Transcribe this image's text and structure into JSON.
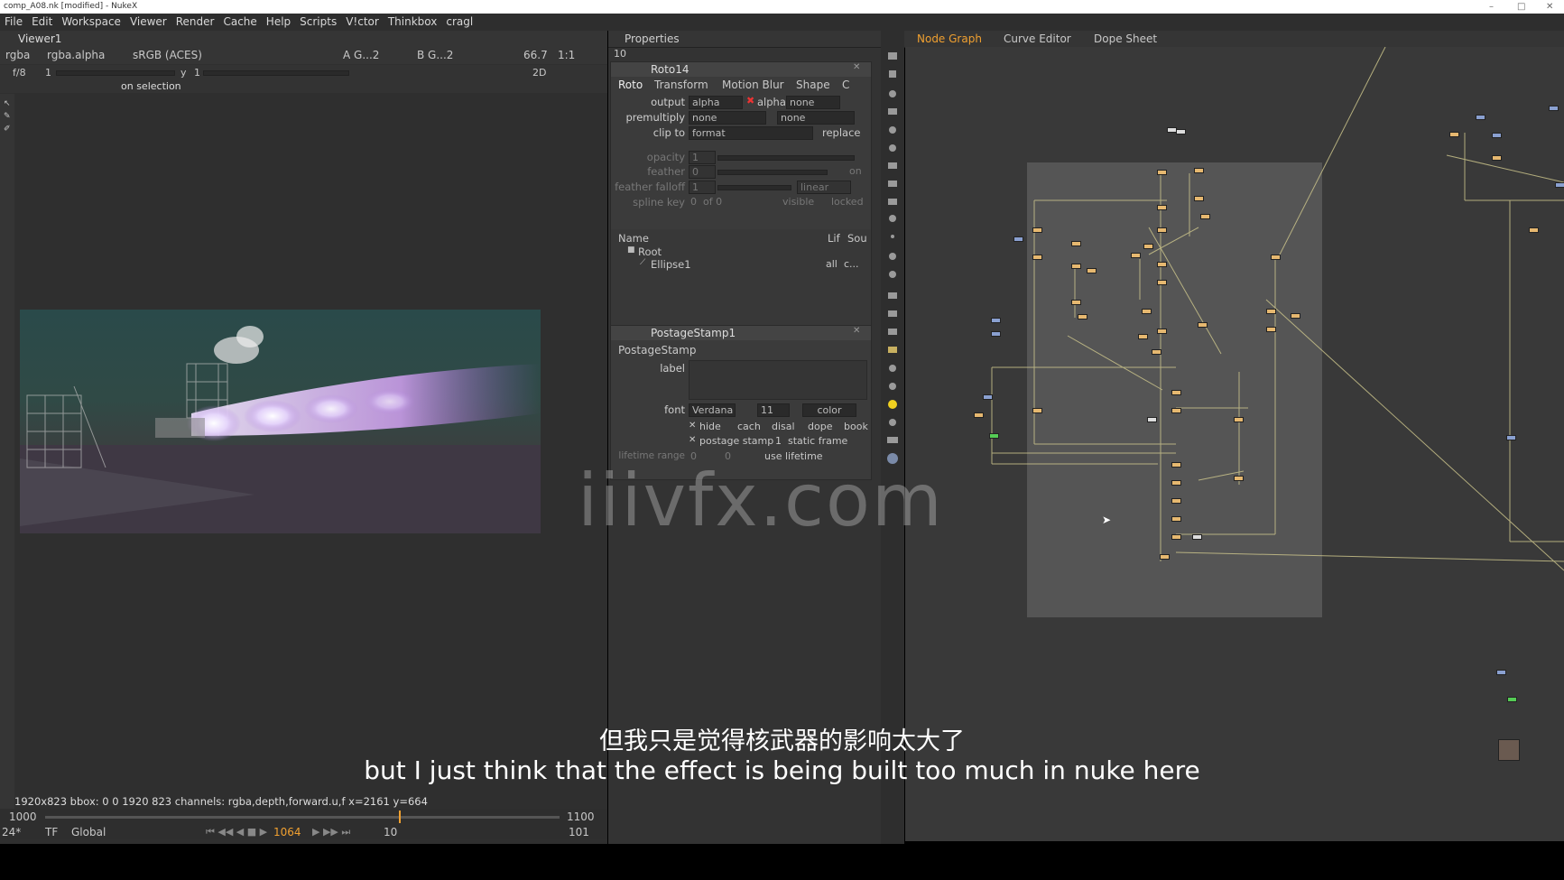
{
  "window": {
    "title": "comp_A08.nk [modified] - NukeX",
    "controls": [
      "–",
      "□",
      "✕"
    ]
  },
  "menu": [
    "File",
    "Edit",
    "Workspace",
    "Viewer",
    "Render",
    "Cache",
    "Help",
    "Scripts",
    "V!ctor",
    "Thinkbox",
    "cragl"
  ],
  "viewer": {
    "tab": "Viewer1",
    "channels": "rgba",
    "channel_alpha": "rgba.alpha",
    "colorspace": "sRGB (ACES)",
    "input_a": "A G...2",
    "input_b": "B G...2",
    "zoom": "66.7",
    "ratio": "1:1",
    "fstop": "f/8",
    "gain": "1",
    "gamma_label": "y",
    "gamma": "1",
    "mode": "2D",
    "selection": "on selection",
    "status": "1920x823  bbox: 0 0 1920 823 channels: rgba,depth,forward.u,f x=2161 y=664"
  },
  "timeline": {
    "start": "1000",
    "end": "1100",
    "fps": "24*",
    "tf": "TF",
    "scope": "Global",
    "current": "1064",
    "step": "10",
    "end_frame": "101"
  },
  "properties": {
    "tab": "Properties",
    "count": "10",
    "roto": {
      "title": "Roto14",
      "tabs": [
        "Roto",
        "Transform",
        "Motion Blur",
        "Shape",
        "C"
      ],
      "output_label": "output",
      "output": "alpha",
      "alpha_check": "alpha",
      "output_none": "none",
      "premultiply_label": "premultiply",
      "premultiply": "none",
      "premult_none": "none",
      "clip_label": "clip to",
      "clip": "format",
      "replace": "replace",
      "opacity_label": "opacity",
      "opacity": "1",
      "feather_label": "feather",
      "feather": "0",
      "feather_on": "on",
      "falloff_label": "feather falloff",
      "falloff": "1",
      "falloff_type": "linear",
      "spline_label": "spline key",
      "spline_key": "0",
      "spline_of": "of 0",
      "visible": "visible",
      "locked": "locked",
      "tree_headers": [
        "Name",
        "Lif",
        "Sou"
      ],
      "tree": [
        {
          "name": "Root",
          "life": "",
          "src": ""
        },
        {
          "name": "Ellipse1",
          "life": "all",
          "src": "c..."
        }
      ]
    },
    "postage": {
      "title": "PostageStamp1",
      "class_name": "PostageStamp",
      "label_label": "label",
      "font_label": "font",
      "font": "Verdana",
      "font_size": "11",
      "color": "color",
      "flags": [
        "hide",
        "cach",
        "disal",
        "dope",
        "book"
      ],
      "postage_stamp": "postage stamp",
      "stamp_value": "1",
      "static_frame": "static frame",
      "lifetime_label": "lifetime range",
      "lifetime_start": "0",
      "lifetime_end": "0",
      "use_lifetime": "use lifetime"
    }
  },
  "nodegraph": {
    "tabs": [
      "Node Graph",
      "Curve Editor",
      "Dope Sheet"
    ]
  },
  "subtitles": {
    "zh": "但我只是觉得核武器的影响太大了",
    "en": "but I just think that the effect is being built too much in nuke here"
  },
  "watermark": "iiivfx.com",
  "colors": {
    "accent": "#f0a030",
    "panel": "#3a3a3a",
    "backdrop": "#555555",
    "node": "#e6b870"
  }
}
